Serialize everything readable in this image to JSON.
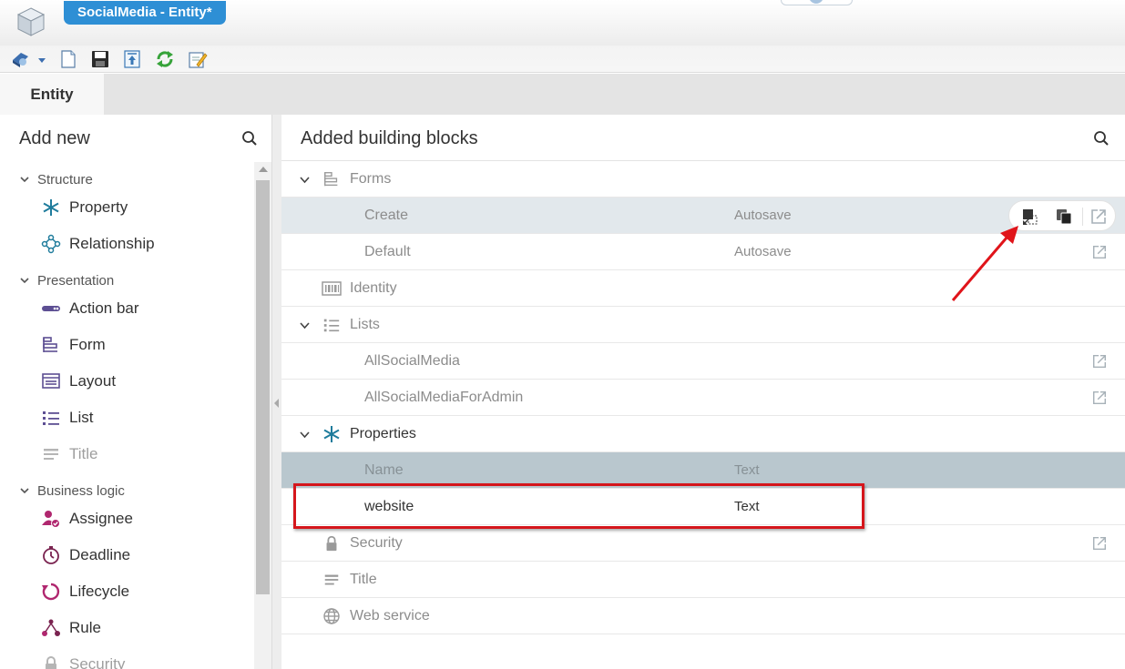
{
  "window": {
    "title": "SocialMedia - Entity*"
  },
  "tabs": [
    {
      "label": "Entity"
    }
  ],
  "left_panel": {
    "title": "Add new",
    "categories": [
      {
        "label": "Structure",
        "items": [
          {
            "label": "Property",
            "icon": "asterisk-icon"
          },
          {
            "label": "Relationship",
            "icon": "relationship-icon"
          }
        ]
      },
      {
        "label": "Presentation",
        "items": [
          {
            "label": "Action bar",
            "icon": "action-bar-icon"
          },
          {
            "label": "Form",
            "icon": "form-icon"
          },
          {
            "label": "Layout",
            "icon": "layout-icon"
          },
          {
            "label": "List",
            "icon": "list-icon"
          },
          {
            "label": "Title",
            "icon": "title-icon"
          }
        ]
      },
      {
        "label": "Business logic",
        "items": [
          {
            "label": "Assignee",
            "icon": "assignee-icon"
          },
          {
            "label": "Deadline",
            "icon": "deadline-icon"
          },
          {
            "label": "Lifecycle",
            "icon": "lifecycle-icon"
          },
          {
            "label": "Rule",
            "icon": "rule-icon"
          },
          {
            "label": "Security",
            "icon": "lock-icon"
          }
        ]
      }
    ]
  },
  "right_panel": {
    "title": "Added building blocks",
    "rows": {
      "forms": {
        "label": "Forms"
      },
      "forms_create": {
        "name": "Create",
        "value": "Autosave"
      },
      "forms_default": {
        "name": "Default",
        "value": "Autosave"
      },
      "identity": {
        "label": "Identity"
      },
      "lists": {
        "label": "Lists"
      },
      "lists_all": {
        "name": "AllSocialMedia"
      },
      "lists_admin": {
        "name": "AllSocialMediaForAdmin"
      },
      "properties": {
        "label": "Properties"
      },
      "properties_header": {
        "name": "Name",
        "value": "Text"
      },
      "properties_website": {
        "name": "website",
        "value": "Text"
      },
      "security": {
        "label": "Security"
      },
      "title": {
        "label": "Title"
      },
      "web_service": {
        "label": "Web service"
      }
    }
  },
  "colors": {
    "accent": "#2e8fd5",
    "annotation": "#d5161c",
    "selected_row": "#e2e8ec",
    "header_row": "#b9c7ce",
    "icon_teal": "#1f7c9c",
    "icon_purple": "#5d4f93",
    "icon_magenta": "#b0276f"
  }
}
